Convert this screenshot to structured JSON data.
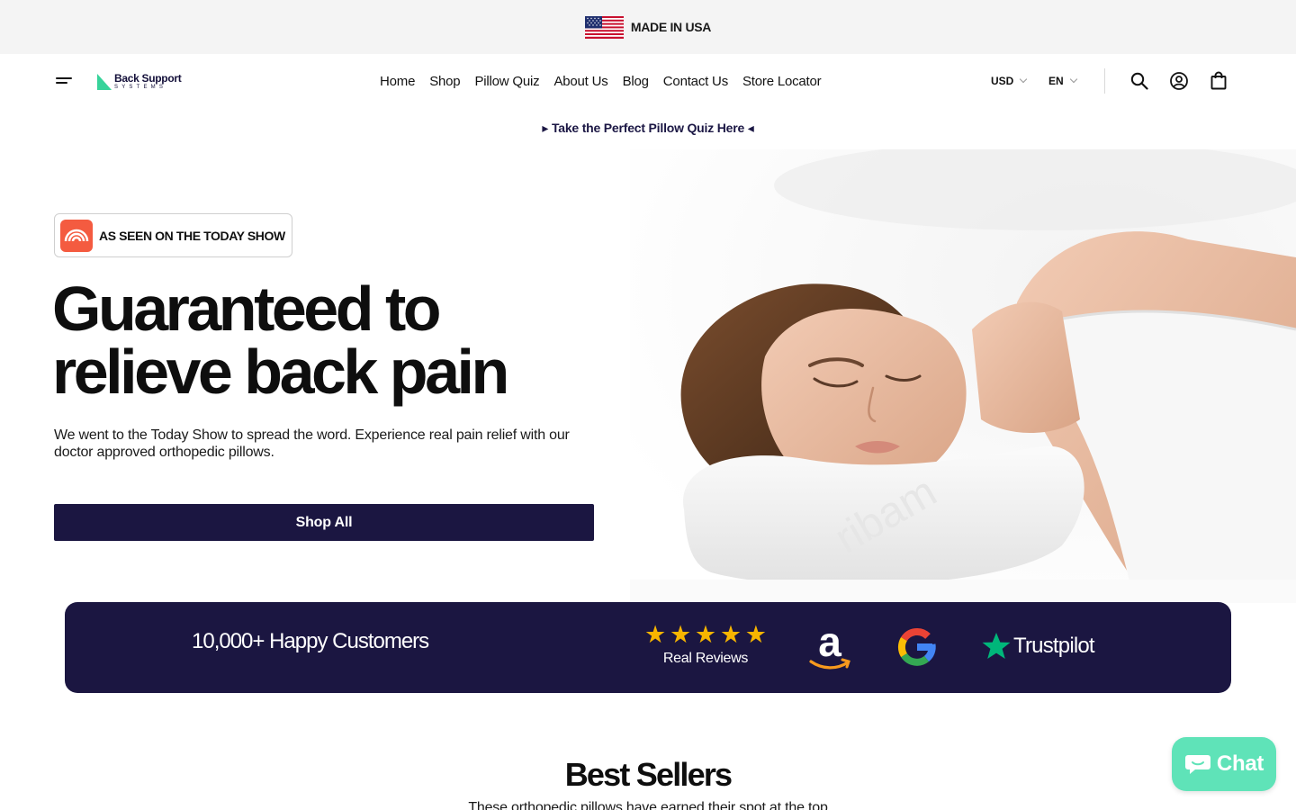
{
  "announcement": {
    "text": "MADE IN USA",
    "icon": "us-flag-icon"
  },
  "header": {
    "logo": {
      "name": "Back Support",
      "tagline": "SYSTEMS"
    },
    "nav": [
      "Home",
      "Shop",
      "Pillow Quiz",
      "About Us",
      "Blog",
      "Contact Us",
      "Store Locator"
    ],
    "currency": "USD",
    "language": "EN",
    "icons": [
      "menu-icon",
      "search-icon",
      "account-icon",
      "cart-icon"
    ]
  },
  "quiz_link": "▸ Take the Perfect Pillow Quiz Here ◂",
  "hero": {
    "badge": "AS SEEN ON THE TODAY SHOW",
    "headline_line1": "Guaranteed to",
    "headline_line2": "relieve back pain",
    "subcopy": "We went to the Today Show to spread the word. Experience real pain relief with our doctor approved orthopedic pillows.",
    "cta": "Shop All"
  },
  "proof": {
    "title": "10,000+ Happy Customers",
    "rating_stars": 5,
    "reviews_label": "Real Reviews",
    "trustpilot": "Trustpilot",
    "icons": [
      "amazon-logo-icon",
      "google-logo-icon",
      "trustpilot-star-icon"
    ]
  },
  "best_sellers": {
    "title": "Best Sellers",
    "subtitle": "These orthopedic pillows have earned their spot at the top"
  },
  "chat": {
    "label": "Chat"
  },
  "colors": {
    "brand_navy": "#1b1641",
    "accent_green": "#37d39a",
    "chat_green": "#5fe3b8",
    "star": "#f7b500",
    "today_orange": "#f45b40"
  }
}
